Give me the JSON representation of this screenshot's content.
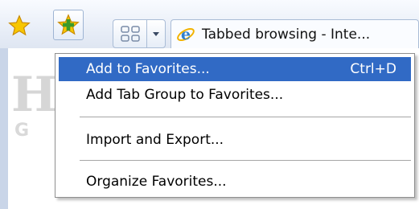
{
  "toolbar": {
    "favorites_center_icon": "favorites-star-icon",
    "add_favorites_icon": "add-favorites-star-icon",
    "quick_tabs_icon": "quick-tabs-icon",
    "tab_list_icon": "chevron-down-icon"
  },
  "tab": {
    "icon": "internet-explorer-icon",
    "title": "Tabbed browsing - Inte..."
  },
  "menu": {
    "items": [
      {
        "label": "Add to Favorites...",
        "shortcut": "Ctrl+D"
      },
      {
        "label": "Add Tab Group to Favorites..."
      },
      {
        "label": "Import and Export..."
      },
      {
        "label": "Organize Favorites..."
      }
    ]
  },
  "colors": {
    "selection": "#316ac5",
    "star": "#f5b800",
    "plus": "#3a9a2a",
    "toolbar": "#e6ecf6"
  }
}
